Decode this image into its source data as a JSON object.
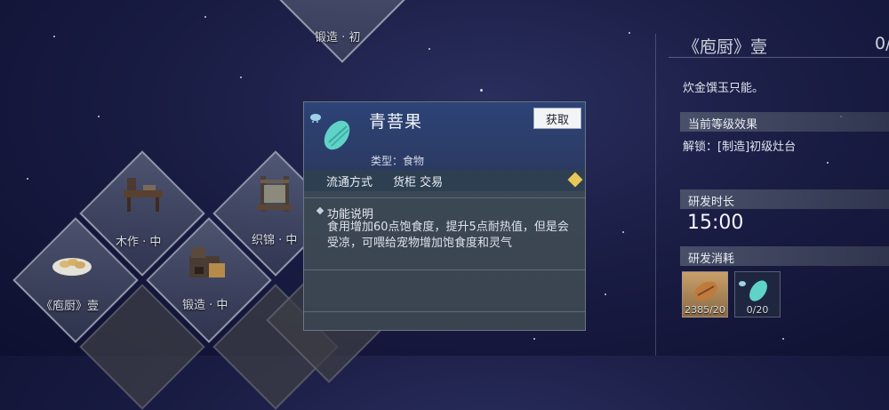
{
  "tiles": {
    "top_partial": "锻造 · 初",
    "woodwork": "木作 · 中",
    "weaving": "织锦 · 中",
    "cookbook": "《庖厨》壹",
    "forging": "锻造 · 中"
  },
  "popup": {
    "title": "青菩果",
    "get_button": "获取",
    "type_label": "类型：食物",
    "trade_label": "流通方式",
    "trade_value": "货柜 交易",
    "func_title": "功能说明",
    "func_text": "食用增加60点饱食度，提升5点耐热值，但是会受凉，可喂给宠物增加饱食度和灵气"
  },
  "panel": {
    "title": "《庖厨》壹",
    "count": "0/",
    "desc": "炊金馔玉只能。",
    "level_effect_label": "当前等级效果",
    "unlock_text": "解锁：[制造]初级灶台",
    "dev_time_label": "研发时长",
    "dev_time": "15:00",
    "dev_cost_label": "研发消耗",
    "costs": [
      {
        "icon": "grain-icon",
        "quantity": "2385/20"
      },
      {
        "icon": "green-fruit-icon",
        "quantity": "0/20"
      }
    ]
  },
  "colors": {
    "popup_header": "#2b3a62",
    "popup_body": "#3a4450",
    "fruit_teal": "#5fd3c7",
    "badge_gold": "#e8c65a"
  }
}
